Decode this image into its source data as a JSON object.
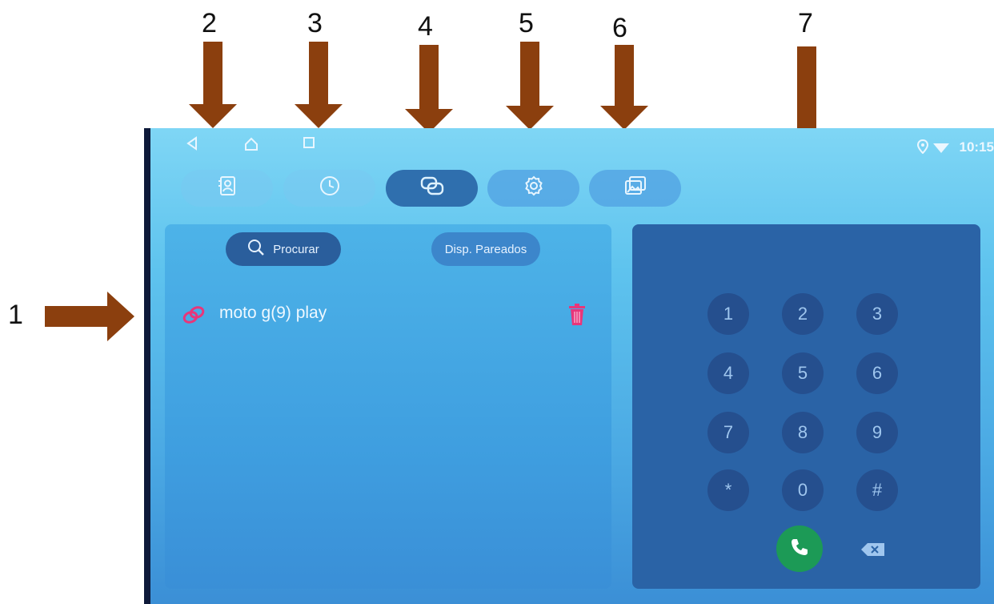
{
  "annotations": {
    "labels": [
      "1",
      "2",
      "3",
      "4",
      "5",
      "6",
      "7"
    ]
  },
  "statusbar": {
    "clock": "10:15"
  },
  "tabs": [
    {
      "name": "contacts-tab",
      "icon": "contacts-book-icon"
    },
    {
      "name": "recent-calls-tab",
      "icon": "clock-icon"
    },
    {
      "name": "connection-tab",
      "icon": "link-icon"
    },
    {
      "name": "settings-tab",
      "icon": "gear-icon"
    },
    {
      "name": "gallery-tab",
      "icon": "image-icon"
    }
  ],
  "left_panel": {
    "search_label": "Procurar",
    "paired_label": "Disp. Pareados",
    "devices": [
      {
        "name": "moto g(9) play"
      }
    ]
  },
  "dialpad": {
    "keys": [
      "1",
      "2",
      "3",
      "4",
      "5",
      "6",
      "7",
      "8",
      "9",
      "*",
      "0",
      "#"
    ]
  },
  "colors": {
    "arrow": "#8B3F0E",
    "accent_pink": "#e8367a",
    "call_green": "#1c9a56"
  }
}
